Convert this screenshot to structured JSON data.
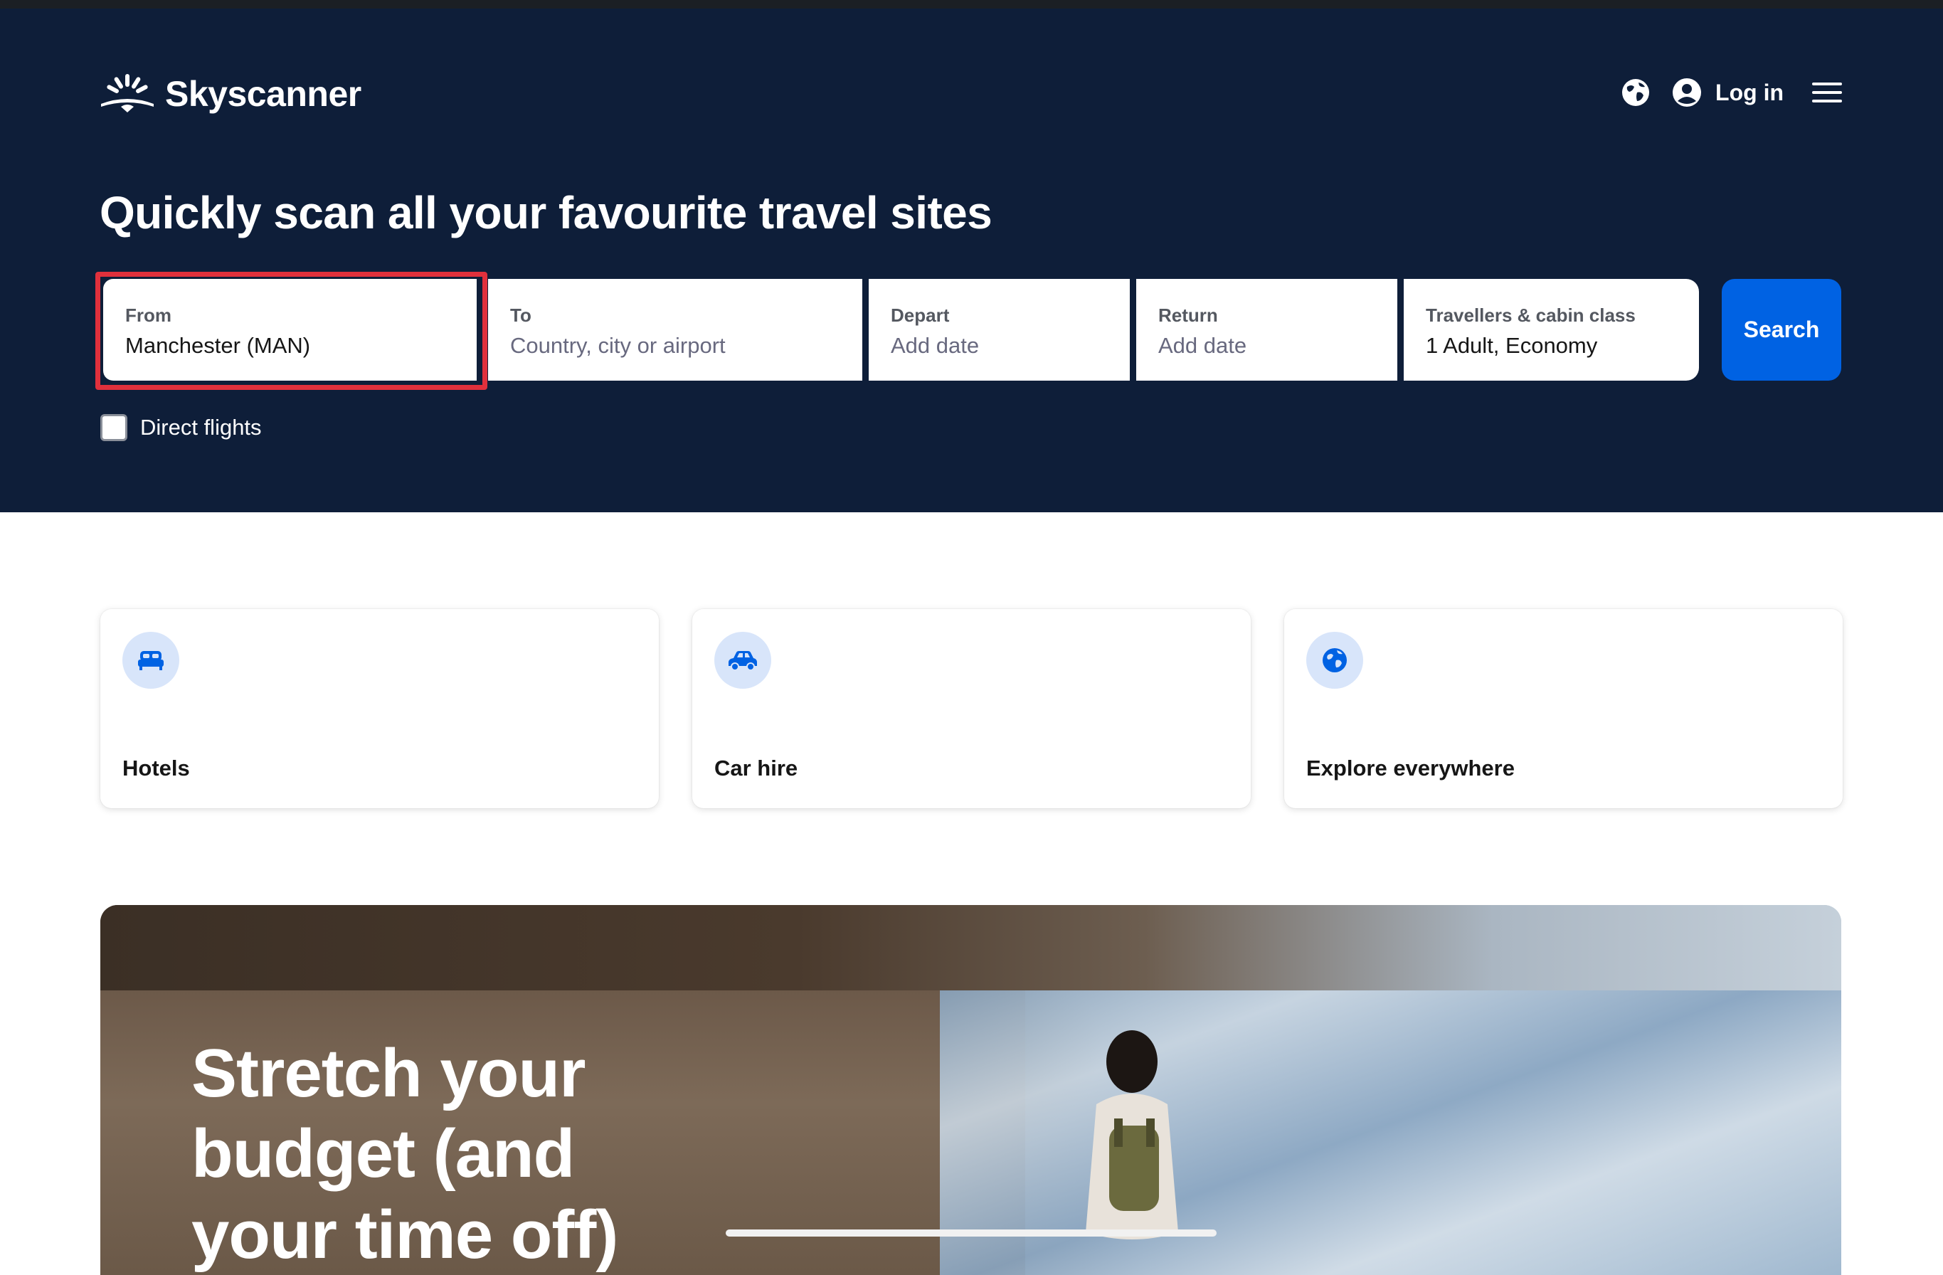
{
  "brand": {
    "name": "Skyscanner"
  },
  "header": {
    "login_label": "Log in",
    "icons": [
      "globe-icon",
      "account-icon",
      "menu-icon"
    ]
  },
  "hero": {
    "headline": "Quickly scan all your favourite travel sites"
  },
  "search": {
    "from": {
      "label": "From",
      "value": "Manchester (MAN)"
    },
    "to": {
      "label": "To",
      "placeholder": "Country, city or airport"
    },
    "depart": {
      "label": "Depart",
      "placeholder": "Add date"
    },
    "return": {
      "label": "Return",
      "placeholder": "Add date"
    },
    "travellers": {
      "label": "Travellers & cabin class",
      "value": "1 Adult, Economy"
    },
    "button_label": "Search",
    "direct_flights_label": "Direct flights",
    "direct_flights_checked": false
  },
  "cards": [
    {
      "label": "Hotels",
      "icon": "bed-icon"
    },
    {
      "label": "Car hire",
      "icon": "car-icon"
    },
    {
      "label": "Explore everywhere",
      "icon": "globe-icon"
    }
  ],
  "promo": {
    "title": "Stretch your budget (and your time off)"
  },
  "colors": {
    "hero_bg": "#0e1e39",
    "accent": "#0062e3",
    "highlight_outline": "#e0303c",
    "icon_circle": "#d8e5fa"
  }
}
